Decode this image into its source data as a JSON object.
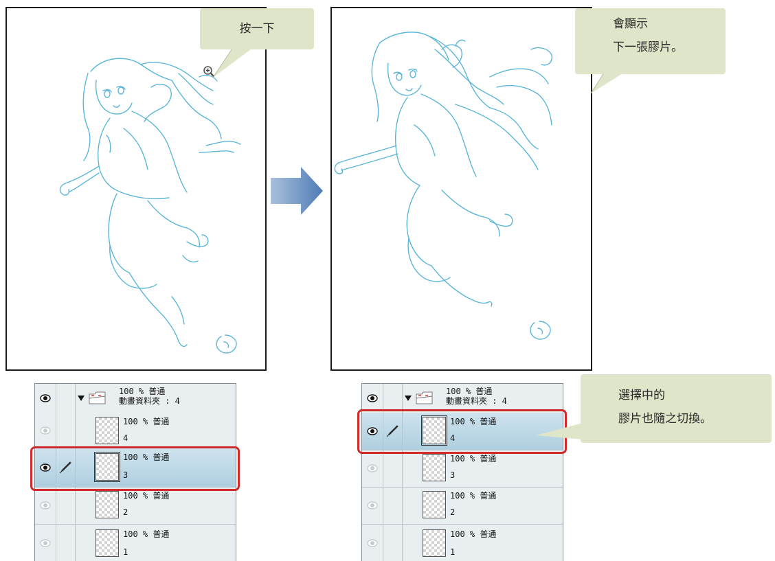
{
  "left_canvas": {
    "callout": "按一下"
  },
  "right_canvas": {
    "callout_line1": "會顯示",
    "callout_line2": "下一張膠片。"
  },
  "layer_callout": {
    "line1": "選擇中的",
    "line2": "膠片也隨之切換。"
  },
  "layer_panel_left": {
    "folder": {
      "blend": "100 % 普通",
      "name": "動畫資料夾 : 4"
    },
    "layers": [
      {
        "blend": "100 % 普通",
        "name": "4",
        "selected": false
      },
      {
        "blend": "100 % 普通",
        "name": "3",
        "selected": true
      },
      {
        "blend": "100 % 普通",
        "name": "2",
        "selected": false
      },
      {
        "blend": "100 % 普通",
        "name": "1",
        "selected": false
      }
    ]
  },
  "layer_panel_right": {
    "folder": {
      "blend": "100 % 普通",
      "name": "動畫資料夾 : 4"
    },
    "layers": [
      {
        "blend": "100 % 普通",
        "name": "4",
        "selected": true
      },
      {
        "blend": "100 % 普通",
        "name": "3",
        "selected": false
      },
      {
        "blend": "100 % 普通",
        "name": "2",
        "selected": false
      },
      {
        "blend": "100 % 普通",
        "name": "1",
        "selected": false
      }
    ]
  },
  "colors": {
    "sketch": "#5cb6d8",
    "callout_bg": "#dfe5c9",
    "highlight": "#d12a2a",
    "arrow": "#4f7bb5"
  },
  "icons": [
    "zoom-in-icon",
    "eye-icon",
    "pen-icon",
    "folder-icon",
    "arrow-right-icon"
  ]
}
